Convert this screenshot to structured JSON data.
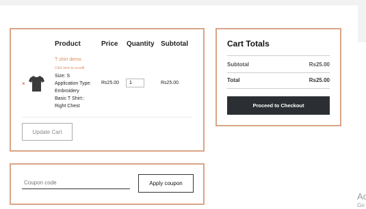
{
  "cart": {
    "headers": {
      "product": "Product",
      "price": "Price",
      "quantity": "Quantity",
      "subtotal": "Subtotal"
    },
    "item": {
      "name": "T shirt demo",
      "edit_link": "Click here to re-edit",
      "size": "Size: S",
      "application_type_line1": "Application Type:",
      "application_type_line2": "Embroidery",
      "basic_line1": "Basic T Shirt::",
      "basic_line2": "Right Chest",
      "price": "Rs25.00",
      "quantity": "1",
      "subtotal": "Rs25.00",
      "remove_glyph": "×",
      "remove_icon": "remove-icon",
      "thumbnail_icon": "tshirt-icon"
    },
    "update_button": "Update Cart"
  },
  "coupon": {
    "placeholder": "Coupon code",
    "apply_button": "Apply coupon"
  },
  "totals": {
    "title": "Cart Totals",
    "subtotal_label": "Subtotal",
    "subtotal_value": "Rs25.00",
    "total_label": "Total",
    "total_value": "Rs25.00",
    "checkout_button": "Proceed to Checkout"
  },
  "watermark": {
    "line1": "Ac",
    "line2": "Go"
  },
  "colors": {
    "accent_border": "#d9a386",
    "product_link": "#d98c5f",
    "checkout_bg": "#2b2f33"
  }
}
